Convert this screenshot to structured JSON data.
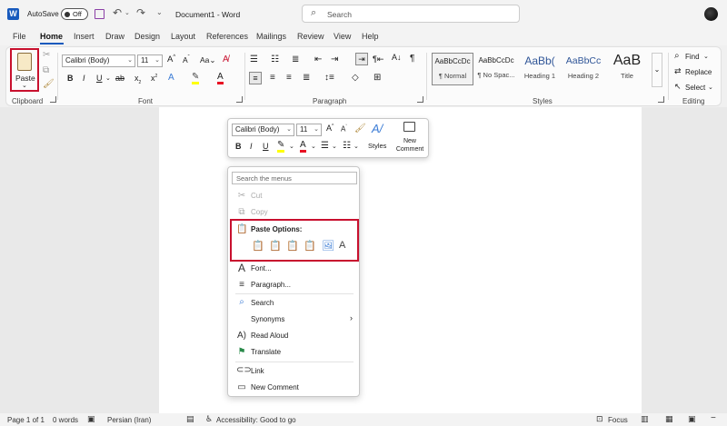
{
  "titlebar": {
    "autosave_label": "AutoSave",
    "autosave_state": "Off",
    "doc_title": "Document1 - Word",
    "search_placeholder": "Search"
  },
  "tabs": [
    "File",
    "Home",
    "Insert",
    "Draw",
    "Design",
    "Layout",
    "References",
    "Mailings",
    "Review",
    "View",
    "Help"
  ],
  "ribbon": {
    "clipboard": {
      "paste_label": "Paste",
      "group_label": "Clipboard"
    },
    "font": {
      "font_name": "Calibri (Body)",
      "font_size": "11",
      "group_label": "Font"
    },
    "paragraph": {
      "group_label": "Paragraph"
    },
    "styles": {
      "group_label": "Styles",
      "items": [
        {
          "sample": "AaBbCcDc",
          "name": "¶ Normal"
        },
        {
          "sample": "AaBbCcDc",
          "name": "¶ No Spac..."
        },
        {
          "sample": "AaBb(",
          "name": "Heading 1"
        },
        {
          "sample": "AaBbCc",
          "name": "Heading 2"
        },
        {
          "sample": "AaB",
          "name": "Title"
        }
      ]
    },
    "editing": {
      "group_label": "Editing",
      "find": "Find",
      "replace": "Replace",
      "select": "Select"
    }
  },
  "mini_toolbar": {
    "font_name": "Calibri (Body)",
    "font_size": "11",
    "styles_label": "Styles",
    "new_comment_label": "New Comment"
  },
  "context_menu": {
    "search_placeholder": "Search the menus",
    "cut": "Cut",
    "copy": "Copy",
    "paste_options": "Paste Options:",
    "font": "Font...",
    "paragraph": "Paragraph...",
    "search": "Search",
    "synonyms": "Synonyms",
    "read_aloud": "Read Aloud",
    "translate": "Translate",
    "link": "Link",
    "new_comment": "New Comment"
  },
  "status": {
    "page": "Page 1 of 1",
    "words": "0 words",
    "language": "Persian (Iran)",
    "accessibility": "Accessibility: Good to go",
    "focus": "Focus"
  },
  "colors": {
    "word_blue": "#185abd",
    "highlight_red": "#c8102e",
    "font_color_red": "#e81123",
    "highlight_yellow": "#ffff00"
  }
}
